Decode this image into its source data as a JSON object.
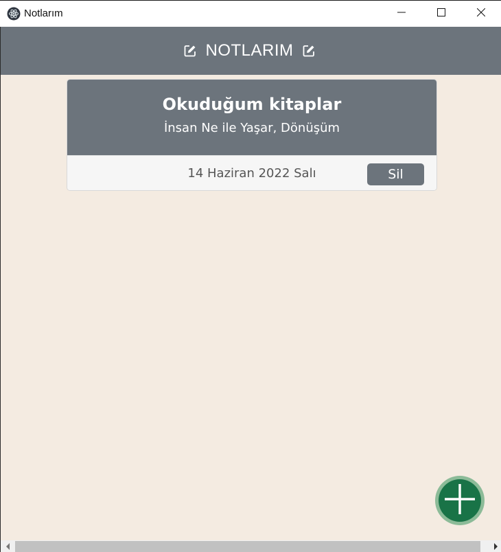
{
  "window": {
    "title": "Notlarım",
    "icon": "electron-app-icon",
    "controls": [
      "minimize-icon",
      "maximize-icon",
      "close-icon"
    ]
  },
  "header": {
    "title": "NOTLARIM",
    "left_icon": "edit-icon",
    "right_icon": "edit-icon"
  },
  "notes": [
    {
      "title": "Okuduğum kitaplar",
      "text": "İnsan Ne ile Yaşar, Dönüşüm",
      "date": "14 Haziran 2022 Salı",
      "delete_label": "Sil"
    }
  ],
  "fab": {
    "icon": "plus-icon"
  },
  "colors": {
    "background": "#f4ebe1",
    "header": "#6c747c",
    "card_body": "#6c747c",
    "fab": "#197347",
    "fab_ring": "#8cbb98"
  }
}
